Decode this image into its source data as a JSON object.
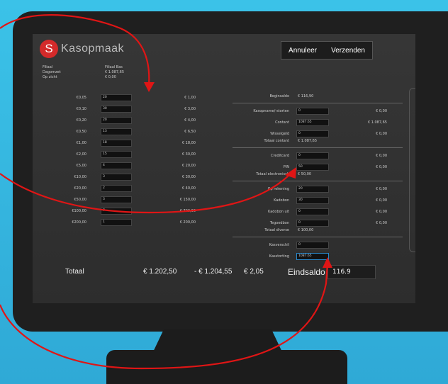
{
  "app": {
    "logo_letter": "S",
    "logo_text": "Kasopmaak"
  },
  "toolbar": {
    "cancel_label": "Annuleer",
    "send_label": "Verzenden"
  },
  "info": {
    "labels": [
      "Filiaal",
      "Dagomzet",
      "Op zicht"
    ],
    "values": [
      "Filiaal Bas",
      "€ 1.087,65",
      "€ 0,00"
    ]
  },
  "coins": [
    {
      "denom": "€0,05",
      "count": "20",
      "total": "€ 1,00"
    },
    {
      "denom": "€0,10",
      "count": "30",
      "total": "€ 3,00"
    },
    {
      "denom": "€0,20",
      "count": "20",
      "total": "€ 4,00"
    },
    {
      "denom": "€0,50",
      "count": "13",
      "total": "€ 6,50"
    },
    {
      "denom": "€1,00",
      "count": "18",
      "total": "€ 18,00"
    },
    {
      "denom": "€2,00",
      "count": "15",
      "total": "€ 30,00"
    },
    {
      "denom": "€5,00",
      "count": "4",
      "total": "€ 20,00"
    },
    {
      "denom": "€10,00",
      "count": "3",
      "total": "€ 30,00"
    },
    {
      "denom": "€20,00",
      "count": "2",
      "total": "€ 40,00"
    },
    {
      "denom": "€50,00",
      "count": "3",
      "total": "€ 150,00"
    },
    {
      "denom": "€100,00",
      "count": "7",
      "total": "€ 700,00"
    },
    {
      "denom": "€200,00",
      "count": "1",
      "total": "€ 200,00"
    }
  ],
  "right": {
    "beginsaldo_label": "Beginsaldo",
    "beginsaldo_value": "€ 116,90",
    "kasopname_label": "Kasopname/-storten",
    "kasopname_input": "0",
    "kasopname_amount": "€ 0,00",
    "contant_label": "Contant",
    "contant_input": "1087.65",
    "contant_amount": "€ 1.087,65",
    "wisselgeld_label": "Wisselgeld",
    "wisselgeld_input": "0",
    "wisselgeld_amount": "€ 0,00",
    "totaal_contant_label": "Totaal contant",
    "totaal_contant_value": "€ 1.087,65",
    "creditcard_label": "Creditcard",
    "creditcard_input": "0",
    "creditcard_amount": "€ 0,00",
    "pin_label": "PIN",
    "pin_input": "50",
    "pin_amount": "€ 0,00",
    "totaal_elec_label": "Totaal electronisch",
    "totaal_elec_value": "€ 50,00",
    "oprekening_label": "Op rekening",
    "oprekening_input": "20",
    "oprekening_amount": "€ 0,00",
    "kadobon_label": "Kadobon",
    "kadobon_input": "30",
    "kadobon_amount": "€ 0,00",
    "kadobon_uit_label": "Kadobon uit",
    "kadobon_uit_input": "0",
    "kadobon_uit_amount": "€ 0,00",
    "tegoedbon_label": "Tegoedbon",
    "tegoedbon_input": "0",
    "tegoedbon_amount": "€ 0,00",
    "totaal_div_label": "Totaal diverse",
    "totaal_div_value": "€ 100,00",
    "kasverschil_label": "Kasverschil",
    "kasverschil_input": "0",
    "kasstorting_label": "Kasstorting",
    "kasstorting_input": "1087.65"
  },
  "totals": {
    "label": "Totaal",
    "sum": "€ 1.202,50",
    "minus": "- € 1.204,55",
    "diff": "€ 2,05",
    "eindsaldo_label": "Eindsaldo",
    "eindsaldo_value": "116.9"
  },
  "colors": {
    "arrow": "#e01515",
    "background": "#3bc2e8",
    "input_focus": "#2a86c8"
  }
}
